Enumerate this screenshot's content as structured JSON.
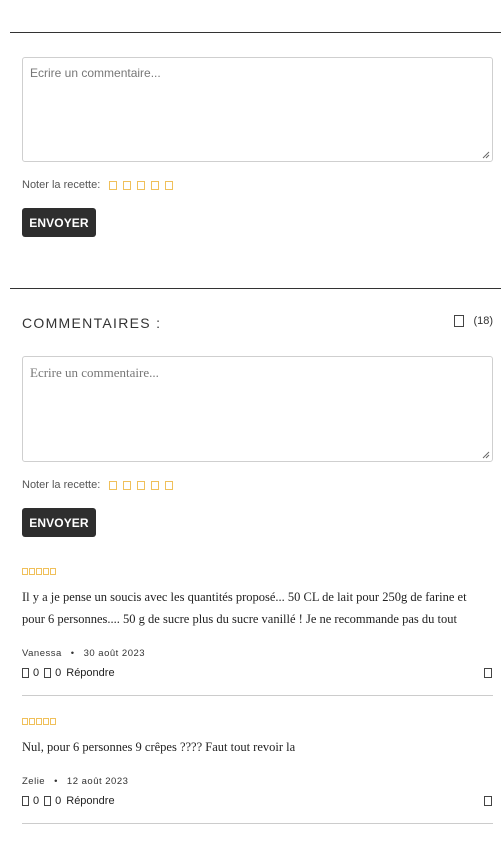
{
  "form1": {
    "placeholder": "Ecrire un commentaire...",
    "rate_label": "Noter la recette:",
    "stars_count": 5,
    "submit_label": "ENVOYER"
  },
  "comments_section": {
    "title": "COMMENTAIRES :",
    "count": "(18)"
  },
  "form2": {
    "placeholder": "Ecrire un commentaire...",
    "rate_label": "Noter la recette:",
    "stars_count": 5,
    "submit_label": "ENVOYER"
  },
  "comments": [
    {
      "rating_stars": 5,
      "text": "Il y a je pense un soucis avec les quantités proposé... 50 CL de lait pour 250g de farine et pour 6 personnes.... 50 g de sucre plus du sucre vanillé ! Je ne recommande pas du tout",
      "author": "Vanessa",
      "date": "30 août 2023",
      "likes": "0",
      "dislikes": "0",
      "reply_label": "Répondre"
    },
    {
      "rating_stars": 5,
      "text": "Nul, pour 6 personnes 9 crêpes ???? Faut tout revoir la",
      "author": "Zelie",
      "date": "12 août 2023",
      "likes": "0",
      "dislikes": "0",
      "reply_label": "Répondre"
    }
  ],
  "colors": {
    "button_bg": "#2e2e2e",
    "star_outline": "#f0c05a",
    "divider": "#333333"
  }
}
